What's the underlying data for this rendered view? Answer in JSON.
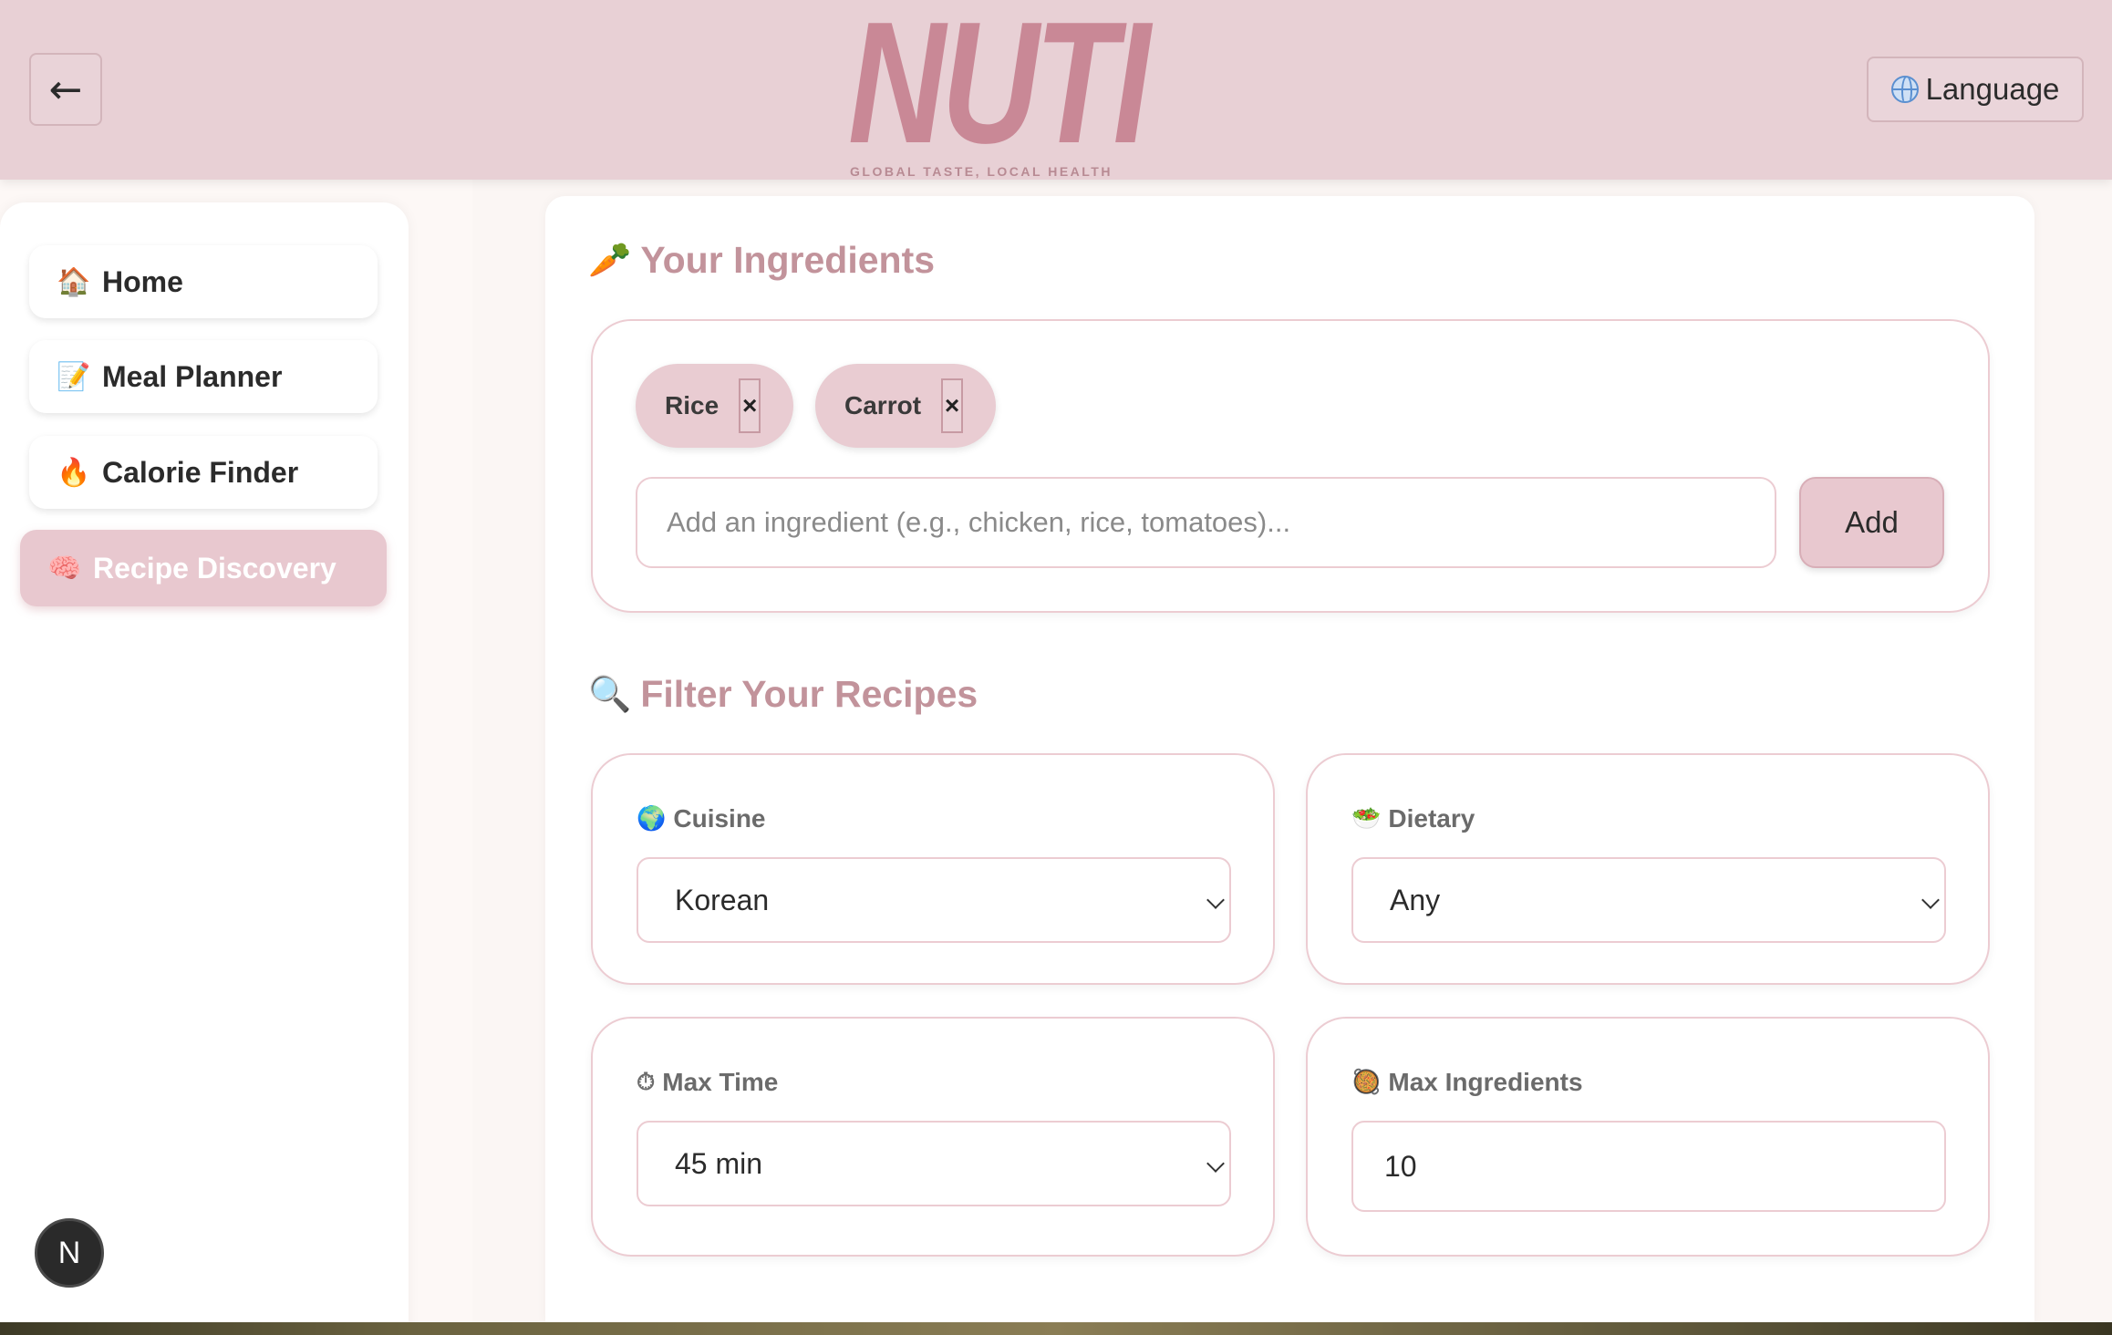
{
  "header": {
    "back_glyph": "←",
    "logo_text": "NUTI",
    "tagline": "GLOBAL TASTE, LOCAL HEALTH",
    "language_label": "Language"
  },
  "sidebar": {
    "items": [
      {
        "icon": "🏠",
        "icon_name": "house-icon",
        "label": "Home"
      },
      {
        "icon": "📝",
        "icon_name": "memo-icon",
        "label": "Meal Planner"
      },
      {
        "icon": "🔥",
        "icon_name": "fire-icon",
        "label": "Calorie Finder"
      },
      {
        "icon": "🧠",
        "icon_name": "brain-icon",
        "label": "Recipe Discovery",
        "active": true
      }
    ],
    "badge_letter": "N"
  },
  "ingredients": {
    "title_icon": "🥕",
    "title": "Your Ingredients",
    "chips": [
      {
        "label": "Rice",
        "remove": "×"
      },
      {
        "label": "Carrot",
        "remove": "×"
      }
    ],
    "input_placeholder": "Add an ingredient (e.g., chicken, rice, tomatoes)...",
    "add_label": "Add"
  },
  "filters": {
    "title_icon": "🔍",
    "title": "Filter Your Recipes",
    "cuisine": {
      "icon": "🌍",
      "label": "Cuisine",
      "value": "Korean"
    },
    "dietary": {
      "icon": "🥗",
      "label": "Dietary",
      "value": "Any"
    },
    "max_time": {
      "icon": "⏱",
      "label": "Max Time",
      "value": "45 min"
    },
    "max_ingredients": {
      "icon": "🥘",
      "label": "Max Ingredients",
      "value": "10"
    }
  },
  "colors": {
    "header_bg": "#e8d0d5",
    "accent": "#e8c8cf",
    "title_color": "#c2939b",
    "border": "#ecccd2"
  }
}
